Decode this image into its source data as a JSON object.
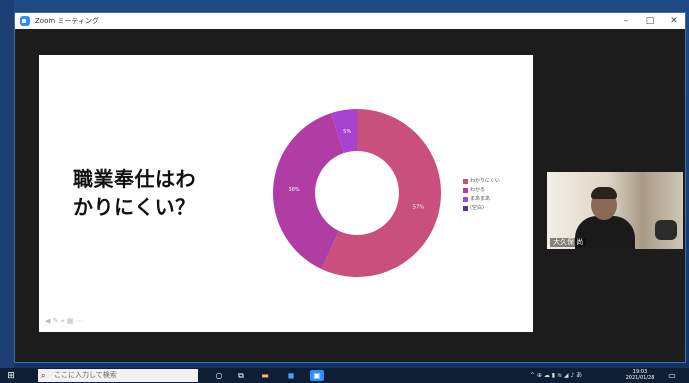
{
  "window": {
    "title": "Zoom ミーティング",
    "minimize": "–",
    "maximize": "□",
    "close": "✕"
  },
  "slide": {
    "heading_line1": "職業奉仕はわ",
    "heading_line2": "かりにくい？",
    "chart_data": {
      "type": "pie",
      "donut": true,
      "series": [
        {
          "label": "わかりにくい",
          "value": 57,
          "color": "#c94f7c"
        },
        {
          "label": "わかる",
          "value": 38,
          "color": "#b03da3"
        },
        {
          "label": "まあまあ",
          "value": 5,
          "color": "#a742d1"
        },
        {
          "label": "(空白)",
          "value": 0,
          "color": "#5b2ea6"
        }
      ],
      "data_labels": [
        "57%",
        "38%",
        "5%"
      ],
      "legend_position": "right"
    }
  },
  "participant": {
    "name": "大久保 尚"
  },
  "taskbar": {
    "search_placeholder": "ここに入力して検索",
    "clock_time": "19:03",
    "clock_date": "2021/01/28"
  },
  "colors": {
    "titlebar": "#ffffff",
    "meeting_bg": "#1c1c1c",
    "taskbar": "#0f1e35",
    "zoom_blue": "#2d8cff"
  },
  "icons": {
    "start": "windows-start-icon",
    "search": "search-icon",
    "task_view": "task-view-icon",
    "explorer": "file-explorer-icon",
    "zoom": "zoom-icon"
  }
}
